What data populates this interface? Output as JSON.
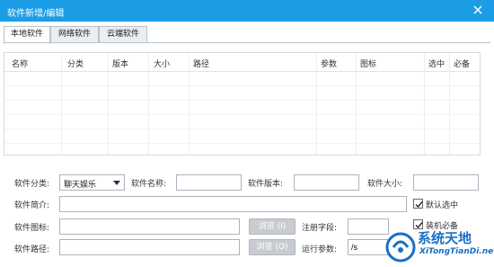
{
  "window": {
    "title": "软件新增/编辑"
  },
  "tabs": [
    {
      "label": "本地软件",
      "active": true
    },
    {
      "label": "网络软件",
      "active": false
    },
    {
      "label": "云端软件",
      "active": false
    }
  ],
  "table": {
    "columns": [
      "名称",
      "分类",
      "版本",
      "大小",
      "路径",
      "参数",
      "图标",
      "选中",
      "必备"
    ],
    "rows": []
  },
  "form": {
    "category_label": "软件分类:",
    "category_value": "聊天娱乐",
    "name_label": "软件名称:",
    "name_value": "",
    "version_label": "软件版本:",
    "version_value": "",
    "size_label": "软件大小:",
    "size_value": "",
    "intro_label": "软件简介:",
    "intro_value": "",
    "default_select_label": "默认选中",
    "default_select_checked": true,
    "icon_label": "软件图标:",
    "icon_value": "",
    "browse_label": "浏览",
    "browse_shortcut": "(I)",
    "reg_label": "注册字段:",
    "reg_value": "",
    "required_label": "装机必备",
    "required_checked": true,
    "path_label": "软件路径:",
    "path_value": "",
    "browse2_label": "浏览",
    "browse2_shortcut": "(O)",
    "params_label": "运行参数:",
    "params_value": "/s"
  },
  "watermark": {
    "text": "系统天地",
    "url": "XiTongTianDi.net"
  },
  "colors": {
    "titlebar": "#1c9ee6",
    "accent": "#1a6fc4",
    "button_disabled": "#c8ccd0"
  }
}
